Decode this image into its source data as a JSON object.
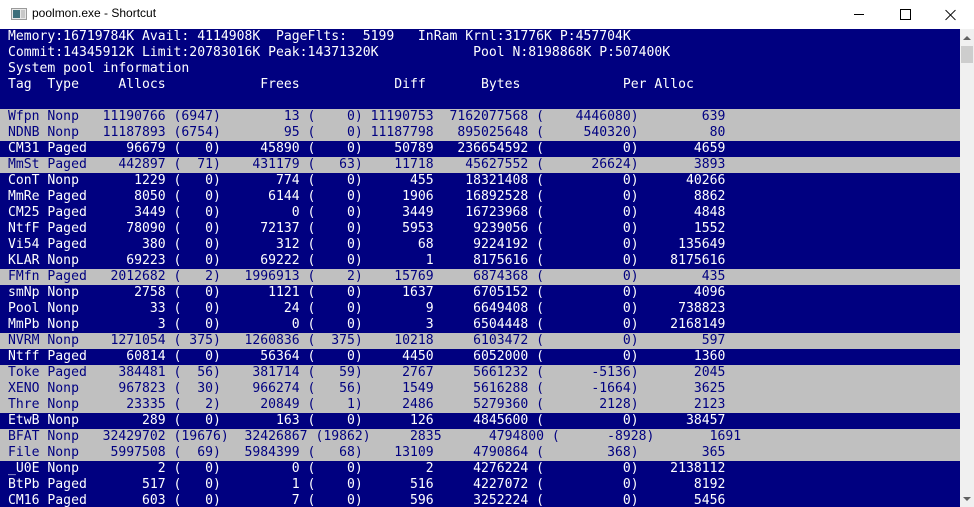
{
  "window": {
    "title": "poolmon.exe - Shortcut",
    "icon": "console-window-icon",
    "controls": [
      "minimize",
      "maximize",
      "close"
    ]
  },
  "summary": {
    "line1": "Memory:16719784K Avail: 4114908K  PageFlts:  5199   InRam Krnl:31776K P:457704K",
    "line2": "Commit:14345912K Limit:20783016K Peak:14371320K            Pool N:8198868K P:507400K",
    "line3": "System pool information",
    "header": "Tag  Type     Allocs            Frees            Diff       Bytes             Per Alloc"
  },
  "colors": {
    "console_bg": "#000080",
    "console_fg": "#ffffff",
    "highlight_bg": "#c0c0c0",
    "highlight_fg": "#000080"
  },
  "columns": [
    "Tag",
    "Type",
    "Allocs",
    "Frees",
    "Diff",
    "Bytes",
    "Per Alloc"
  ],
  "rows": [
    {
      "tag": "Wfpn",
      "type": "Nonp",
      "allocs": "11190766",
      "allocs_delta": "6947",
      "frees": "13",
      "frees_delta": "0",
      "diff": "11190753",
      "bytes": "7162077568",
      "bytes_delta": "4446080",
      "per_alloc": "639",
      "highlight": true,
      "text": "Wfpn Nonp   11190766 (6947)        13 (    0) 11190753  7162077568 (    4446080)        639"
    },
    {
      "tag": "NDNB",
      "type": "Nonp",
      "allocs": "11187893",
      "allocs_delta": "6754",
      "frees": "95",
      "frees_delta": "0",
      "diff": "11187798",
      "bytes": "895025648",
      "bytes_delta": "540320",
      "per_alloc": "80",
      "highlight": true,
      "text": "NDNB Nonp   11187893 (6754)        95 (    0) 11187798   895025648 (     540320)         80"
    },
    {
      "tag": "CM31",
      "type": "Paged",
      "allocs": "96679",
      "allocs_delta": "0",
      "frees": "45890",
      "frees_delta": "0",
      "diff": "50789",
      "bytes": "236654592",
      "bytes_delta": "0",
      "per_alloc": "4659",
      "highlight": false,
      "text": "CM31 Paged     96679 (   0)     45890 (    0)    50789   236654592 (          0)       4659"
    },
    {
      "tag": "MmSt",
      "type": "Paged",
      "allocs": "442897",
      "allocs_delta": "71",
      "frees": "431179",
      "frees_delta": "63",
      "diff": "11718",
      "bytes": "45627552",
      "bytes_delta": "26624",
      "per_alloc": "3893",
      "highlight": true,
      "text": "MmSt Paged    442897 (  71)    431179 (   63)    11718    45627552 (      26624)       3893"
    },
    {
      "tag": "ConT",
      "type": "Nonp",
      "allocs": "1229",
      "allocs_delta": "0",
      "frees": "774",
      "frees_delta": "0",
      "diff": "455",
      "bytes": "18321408",
      "bytes_delta": "0",
      "per_alloc": "40266",
      "highlight": false,
      "text": "ConT Nonp       1229 (   0)       774 (    0)      455    18321408 (          0)      40266"
    },
    {
      "tag": "MmRe",
      "type": "Paged",
      "allocs": "8050",
      "allocs_delta": "0",
      "frees": "6144",
      "frees_delta": "0",
      "diff": "1906",
      "bytes": "16892528",
      "bytes_delta": "0",
      "per_alloc": "8862",
      "highlight": false,
      "text": "MmRe Paged      8050 (   0)      6144 (    0)     1906    16892528 (          0)       8862"
    },
    {
      "tag": "CM25",
      "type": "Paged",
      "allocs": "3449",
      "allocs_delta": "0",
      "frees": "0",
      "frees_delta": "0",
      "diff": "3449",
      "bytes": "16723968",
      "bytes_delta": "0",
      "per_alloc": "4848",
      "highlight": false,
      "text": "CM25 Paged      3449 (   0)         0 (    0)     3449    16723968 (          0)       4848"
    },
    {
      "tag": "NtfF",
      "type": "Paged",
      "allocs": "78090",
      "allocs_delta": "0",
      "frees": "72137",
      "frees_delta": "0",
      "diff": "5953",
      "bytes": "9239056",
      "bytes_delta": "0",
      "per_alloc": "1552",
      "highlight": false,
      "text": "NtfF Paged     78090 (   0)     72137 (    0)     5953     9239056 (          0)       1552"
    },
    {
      "tag": "Vi54",
      "type": "Paged",
      "allocs": "380",
      "allocs_delta": "0",
      "frees": "312",
      "frees_delta": "0",
      "diff": "68",
      "bytes": "9224192",
      "bytes_delta": "0",
      "per_alloc": "135649",
      "highlight": false,
      "text": "Vi54 Paged       380 (   0)       312 (    0)       68     9224192 (          0)     135649"
    },
    {
      "tag": "KLAR",
      "type": "Nonp",
      "allocs": "69223",
      "allocs_delta": "0",
      "frees": "69222",
      "frees_delta": "0",
      "diff": "1",
      "bytes": "8175616",
      "bytes_delta": "0",
      "per_alloc": "8175616",
      "highlight": false,
      "text": "KLAR Nonp      69223 (   0)     69222 (    0)        1     8175616 (          0)    8175616"
    },
    {
      "tag": "FMfn",
      "type": "Paged",
      "allocs": "2012682",
      "allocs_delta": "2",
      "frees": "1996913",
      "frees_delta": "2",
      "diff": "15769",
      "bytes": "6874368",
      "bytes_delta": "0",
      "per_alloc": "435",
      "highlight": true,
      "text": "FMfn Paged   2012682 (   2)   1996913 (    2)    15769     6874368 (          0)        435"
    },
    {
      "tag": "smNp",
      "type": "Nonp",
      "allocs": "2758",
      "allocs_delta": "0",
      "frees": "1121",
      "frees_delta": "0",
      "diff": "1637",
      "bytes": "6705152",
      "bytes_delta": "0",
      "per_alloc": "4096",
      "highlight": false,
      "text": "smNp Nonp       2758 (   0)      1121 (    0)     1637     6705152 (          0)       4096"
    },
    {
      "tag": "Pool",
      "type": "Nonp",
      "allocs": "33",
      "allocs_delta": "0",
      "frees": "24",
      "frees_delta": "0",
      "diff": "9",
      "bytes": "6649408",
      "bytes_delta": "0",
      "per_alloc": "738823",
      "highlight": false,
      "text": "Pool Nonp         33 (   0)        24 (    0)        9     6649408 (          0)     738823"
    },
    {
      "tag": "MmPb",
      "type": "Nonp",
      "allocs": "3",
      "allocs_delta": "0",
      "frees": "0",
      "frees_delta": "0",
      "diff": "3",
      "bytes": "6504448",
      "bytes_delta": "0",
      "per_alloc": "2168149",
      "highlight": false,
      "text": "MmPb Nonp          3 (   0)         0 (    0)        3     6504448 (          0)    2168149"
    },
    {
      "tag": "NVRM",
      "type": "Nonp",
      "allocs": "1271054",
      "allocs_delta": "375",
      "frees": "1260836",
      "frees_delta": "375",
      "diff": "10218",
      "bytes": "6103472",
      "bytes_delta": "0",
      "per_alloc": "597",
      "highlight": true,
      "text": "NVRM Nonp    1271054 ( 375)   1260836 (  375)    10218     6103472 (          0)        597"
    },
    {
      "tag": "Ntff",
      "type": "Paged",
      "allocs": "60814",
      "allocs_delta": "0",
      "frees": "56364",
      "frees_delta": "0",
      "diff": "4450",
      "bytes": "6052000",
      "bytes_delta": "0",
      "per_alloc": "1360",
      "highlight": false,
      "text": "Ntff Paged     60814 (   0)     56364 (    0)     4450     6052000 (          0)       1360"
    },
    {
      "tag": "Toke",
      "type": "Paged",
      "allocs": "384481",
      "allocs_delta": "56",
      "frees": "381714",
      "frees_delta": "59",
      "diff": "2767",
      "bytes": "5661232",
      "bytes_delta": "-5136",
      "per_alloc": "2045",
      "highlight": true,
      "text": "Toke Paged    384481 (  56)    381714 (   59)     2767     5661232 (      -5136)       2045"
    },
    {
      "tag": "XENO",
      "type": "Nonp",
      "allocs": "967823",
      "allocs_delta": "30",
      "frees": "966274",
      "frees_delta": "56",
      "diff": "1549",
      "bytes": "5616288",
      "bytes_delta": "-1664",
      "per_alloc": "3625",
      "highlight": true,
      "text": "XENO Nonp     967823 (  30)    966274 (   56)     1549     5616288 (      -1664)       3625"
    },
    {
      "tag": "Thre",
      "type": "Nonp",
      "allocs": "23335",
      "allocs_delta": "2",
      "frees": "20849",
      "frees_delta": "1",
      "diff": "2486",
      "bytes": "5279360",
      "bytes_delta": "2128",
      "per_alloc": "2123",
      "highlight": true,
      "text": "Thre Nonp      23335 (   2)     20849 (    1)     2486     5279360 (       2128)       2123"
    },
    {
      "tag": "EtwB",
      "type": "Nonp",
      "allocs": "289",
      "allocs_delta": "0",
      "frees": "163",
      "frees_delta": "0",
      "diff": "126",
      "bytes": "4845600",
      "bytes_delta": "0",
      "per_alloc": "38457",
      "highlight": false,
      "text": "EtwB Nonp        289 (   0)       163 (    0)      126     4845600 (          0)      38457"
    },
    {
      "tag": "BFAT",
      "type": "Nonp",
      "allocs": "32429702",
      "allocs_delta": "19676",
      "frees": "32426867",
      "frees_delta": "19862",
      "diff": "2835",
      "bytes": "4794800",
      "bytes_delta": "-8928",
      "per_alloc": "1691",
      "highlight": true,
      "text": "BFAT Nonp   32429702 (19676)  32426867 (19862)     2835      4794800 (      -8928)       1691"
    },
    {
      "tag": "File",
      "type": "Nonp",
      "allocs": "5997508",
      "allocs_delta": "69",
      "frees": "5984399",
      "frees_delta": "68",
      "diff": "13109",
      "bytes": "4790864",
      "bytes_delta": "368",
      "per_alloc": "365",
      "highlight": true,
      "text": "File Nonp    5997508 (  69)   5984399 (   68)    13109     4790864 (        368)        365"
    },
    {
      "tag": "_U0E",
      "type": "Nonp",
      "allocs": "2",
      "allocs_delta": "0",
      "frees": "0",
      "frees_delta": "0",
      "diff": "2",
      "bytes": "4276224",
      "bytes_delta": "0",
      "per_alloc": "2138112",
      "highlight": false,
      "text": "_U0E Nonp          2 (   0)         0 (    0)        2     4276224 (          0)    2138112"
    },
    {
      "tag": "BtPb",
      "type": "Paged",
      "allocs": "517",
      "allocs_delta": "0",
      "frees": "1",
      "frees_delta": "0",
      "diff": "516",
      "bytes": "4227072",
      "bytes_delta": "0",
      "per_alloc": "8192",
      "highlight": false,
      "text": "BtPb Paged       517 (   0)         1 (    0)      516     4227072 (          0)       8192"
    },
    {
      "tag": "CM16",
      "type": "Paged",
      "allocs": "603",
      "allocs_delta": "0",
      "frees": "7",
      "frees_delta": "0",
      "diff": "596",
      "bytes": "3252224",
      "bytes_delta": "0",
      "per_alloc": "5456",
      "highlight": false,
      "text": "CM16 Paged       603 (   0)         7 (    0)      596     3252224 (          0)       5456"
    }
  ]
}
